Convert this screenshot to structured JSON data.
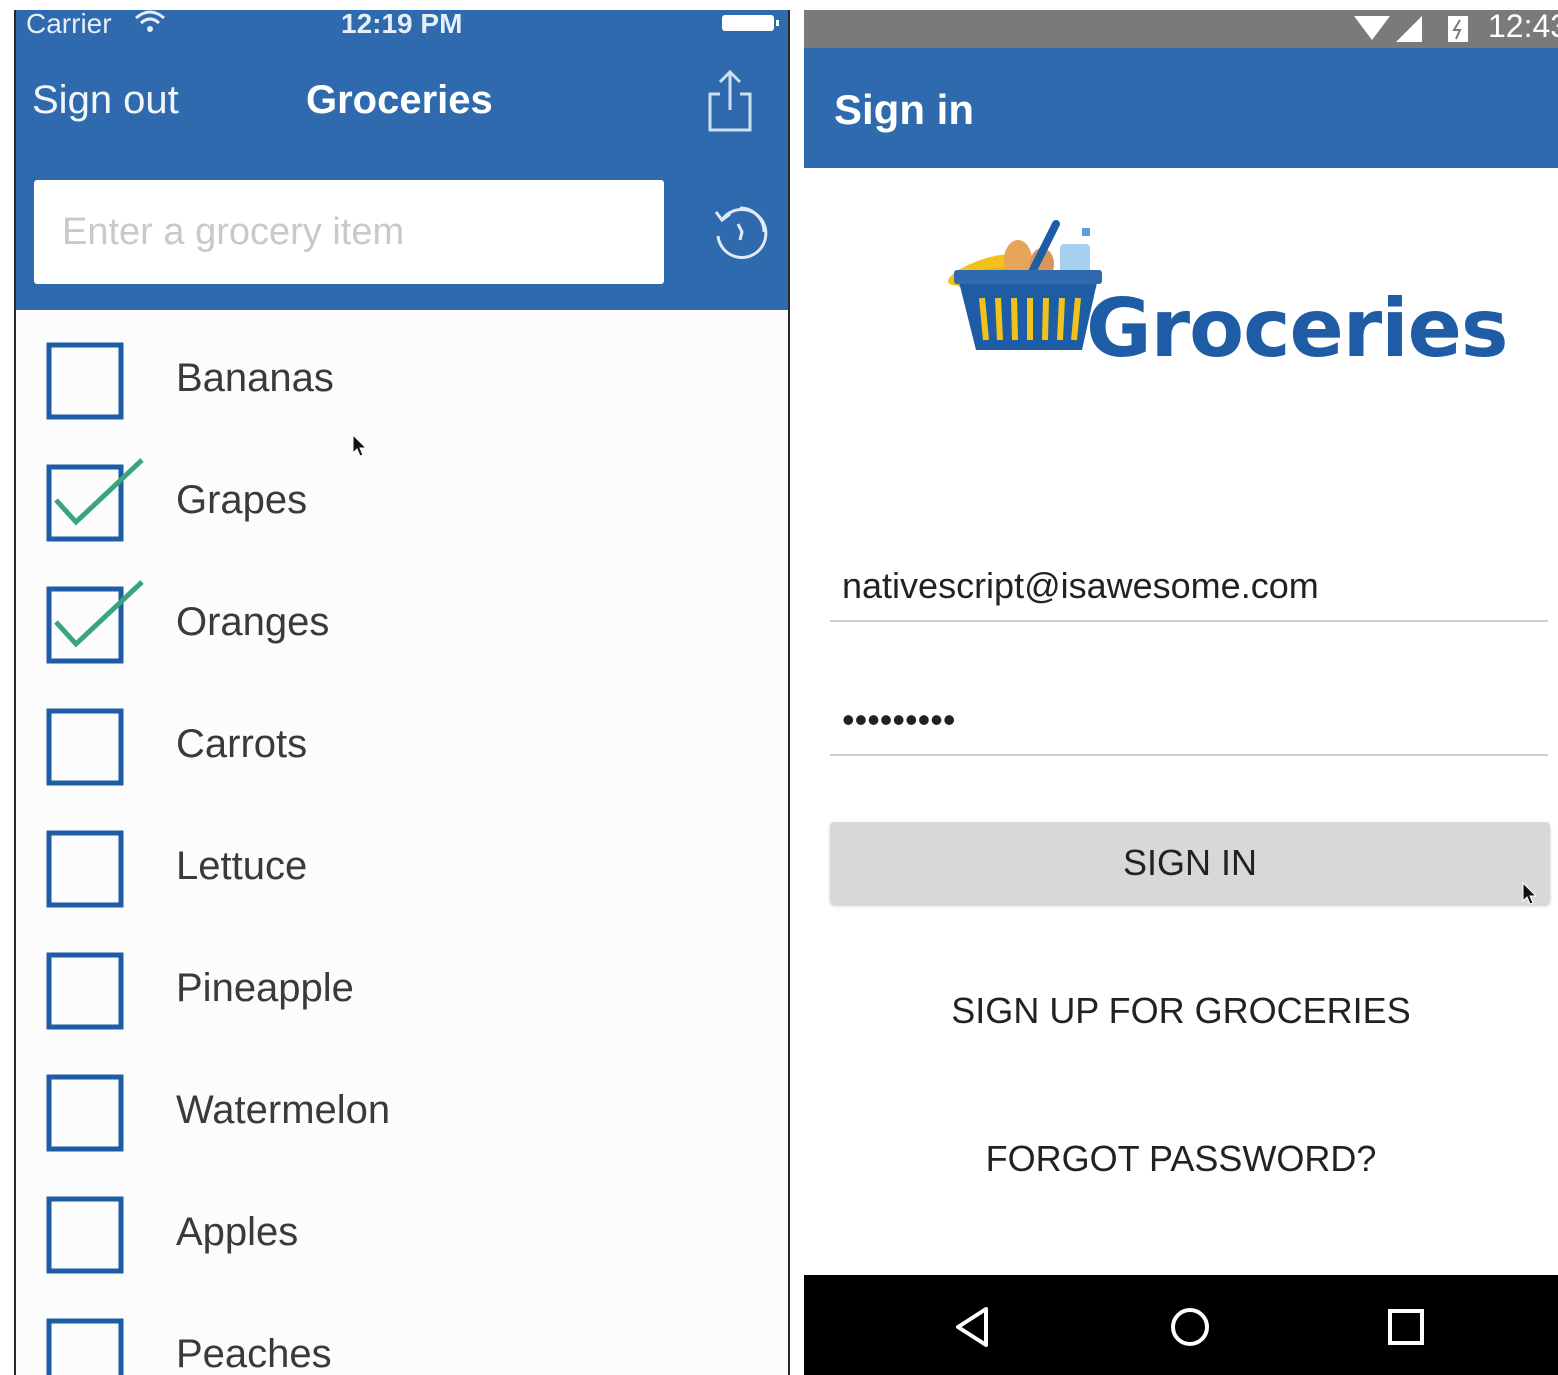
{
  "ios": {
    "status": {
      "carrier": "Carrier",
      "time": "12:19 PM"
    },
    "nav": {
      "sign_out": "Sign out",
      "title": "Groceries"
    },
    "search": {
      "placeholder": "Enter a grocery item"
    },
    "items": [
      {
        "label": "Bananas",
        "checked": false
      },
      {
        "label": "Grapes",
        "checked": true
      },
      {
        "label": "Oranges",
        "checked": true
      },
      {
        "label": "Carrots",
        "checked": false
      },
      {
        "label": "Lettuce",
        "checked": false
      },
      {
        "label": "Pineapple",
        "checked": false
      },
      {
        "label": "Watermelon",
        "checked": false
      },
      {
        "label": "Apples",
        "checked": false
      },
      {
        "label": "Peaches",
        "checked": false
      }
    ]
  },
  "android": {
    "status": {
      "time": "12:43"
    },
    "bar_title": "Sign in",
    "logo_text": "Groceries",
    "email_value": "nativescript@isawesome.com",
    "password_value": "•••••••••",
    "sign_in_label": "SIGN IN",
    "sign_up_label": "SIGN UP FOR GROCERIES",
    "forgot_label": "FORGOT PASSWORD?"
  },
  "colors": {
    "brand_blue": "#2e6aad",
    "check_green": "#3aa57c",
    "logo_blue": "#1f5ca6",
    "button_gray": "#d8d8d8"
  }
}
